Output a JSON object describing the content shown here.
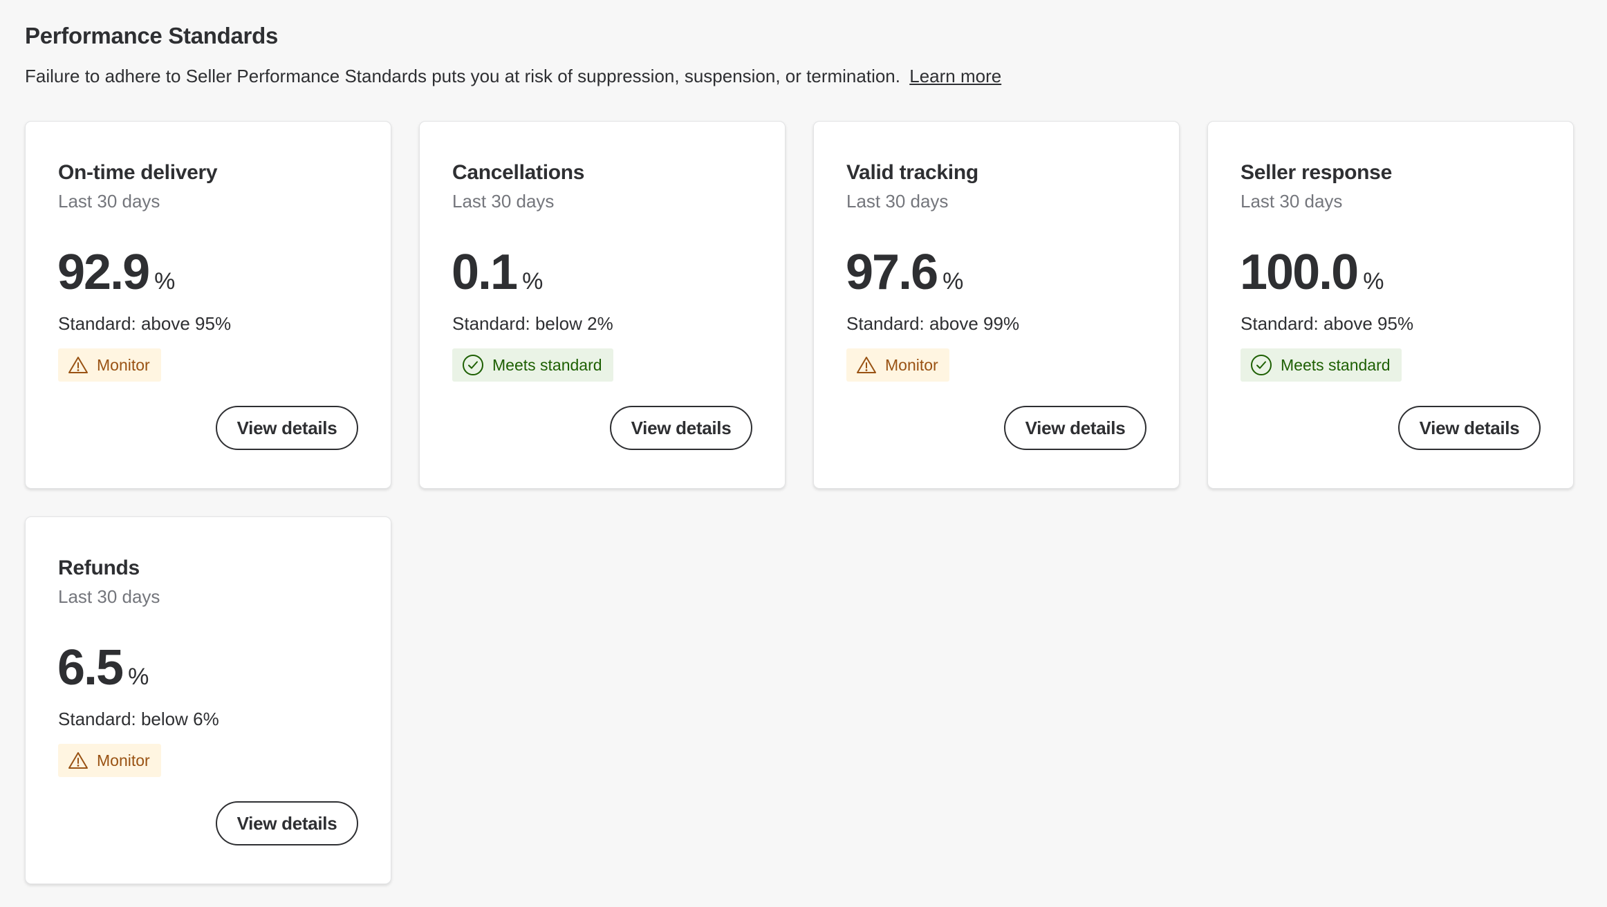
{
  "header": {
    "title": "Performance Standards",
    "description": "Failure to adhere to Seller Performance Standards puts you at risk of suppression, suspension, or termination.",
    "learn_more": "Learn more"
  },
  "colors": {
    "monitor_bg": "#fff5e1",
    "monitor_text": "#995213",
    "meets_bg": "#eaf3e6",
    "meets_text": "#1d5f02"
  },
  "cards": [
    {
      "title": "On-time delivery",
      "period": "Last 30 days",
      "value": "92.9",
      "unit": "%",
      "standard": "Standard: above 95%",
      "status": "Monitor",
      "status_type": "monitor",
      "status_icon": "warning-icon",
      "action": "View details"
    },
    {
      "title": "Cancellations",
      "period": "Last 30 days",
      "value": "0.1",
      "unit": "%",
      "standard": "Standard: below 2%",
      "status": "Meets standard",
      "status_type": "meets",
      "status_icon": "check-circle-icon",
      "action": "View details"
    },
    {
      "title": "Valid tracking",
      "period": "Last 30 days",
      "value": "97.6",
      "unit": "%",
      "standard": "Standard: above 99%",
      "status": "Monitor",
      "status_type": "monitor",
      "status_icon": "warning-icon",
      "action": "View details"
    },
    {
      "title": "Seller response",
      "period": "Last 30 days",
      "value": "100.0",
      "unit": "%",
      "standard": "Standard: above 95%",
      "status": "Meets standard",
      "status_type": "meets",
      "status_icon": "check-circle-icon",
      "action": "View details"
    },
    {
      "title": "Refunds",
      "period": "Last 30 days",
      "value": "6.5",
      "unit": "%",
      "standard": "Standard: below 6%",
      "status": "Monitor",
      "status_type": "monitor",
      "status_icon": "warning-icon",
      "action": "View details"
    }
  ]
}
